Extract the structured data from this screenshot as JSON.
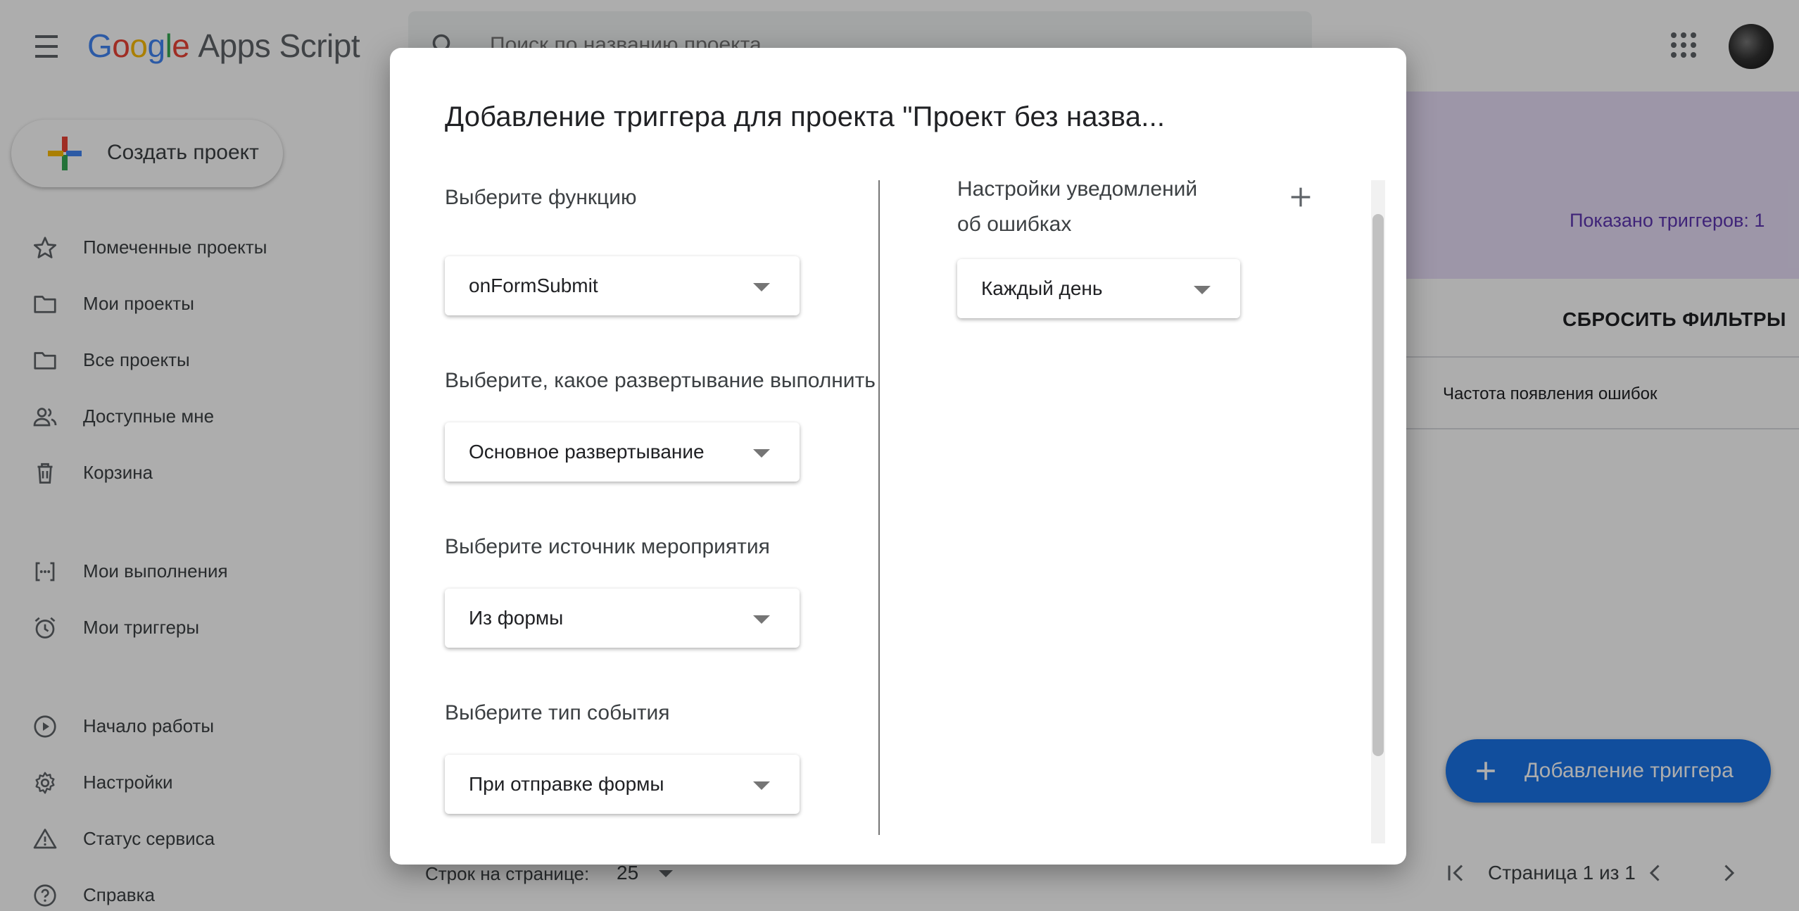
{
  "app": {
    "logo_google": [
      "G",
      "o",
      "o",
      "g",
      "l",
      "e"
    ],
    "logo_product": "Apps Script",
    "search_placeholder": "Поиск по названию проекта"
  },
  "sidebar": {
    "create_button": "Создать проект",
    "items": [
      {
        "label": "Помеченные проекты",
        "icon": "star-icon"
      },
      {
        "label": "Мои проекты",
        "icon": "folder-icon"
      },
      {
        "label": "Все проекты",
        "icon": "folder-icon"
      },
      {
        "label": "Доступные мне",
        "icon": "people-icon"
      },
      {
        "label": "Корзина",
        "icon": "trash-icon"
      },
      {
        "label": "Мои выполнения",
        "icon": "executions-icon"
      },
      {
        "label": "Мои триггеры",
        "icon": "alarm-icon"
      },
      {
        "label": "Начало работы",
        "icon": "play-circle-icon"
      },
      {
        "label": "Настройки",
        "icon": "gear-icon"
      },
      {
        "label": "Статус сервиса",
        "icon": "warning-icon"
      },
      {
        "label": "Справка",
        "icon": "help-icon"
      }
    ]
  },
  "main": {
    "shown_triggers": "Показано триггеров: 1",
    "reset_filters": "СБРОСИТЬ ФИЛЬТРЫ",
    "error_frequency_header": "Частота появления ошибок",
    "add_trigger_button": "Добавление триггера",
    "rows_per_page_label": "Строк на странице:",
    "rows_per_page_value": "25",
    "page_info": "Страница 1 из 1"
  },
  "dialog": {
    "title": "Добавление триггера для проекта \"Проект без назва...",
    "function_label": "Выберите функцию",
    "function_value": "onFormSubmit",
    "deployment_label": "Выберите, какое развертывание выполнить",
    "deployment_value": "Основное развертывание",
    "event_source_label": "Выберите источник мероприятия",
    "event_source_value": "Из формы",
    "event_type_label": "Выберите тип события",
    "event_type_value": "При отправке формы",
    "notify_label": "Настройки уведомлений об ошибках",
    "notify_value": "Каждый день"
  },
  "colors": {
    "accent": "#1a73e8",
    "header_bg": "#e8def8",
    "shown_count_text": "#5e35b1"
  }
}
